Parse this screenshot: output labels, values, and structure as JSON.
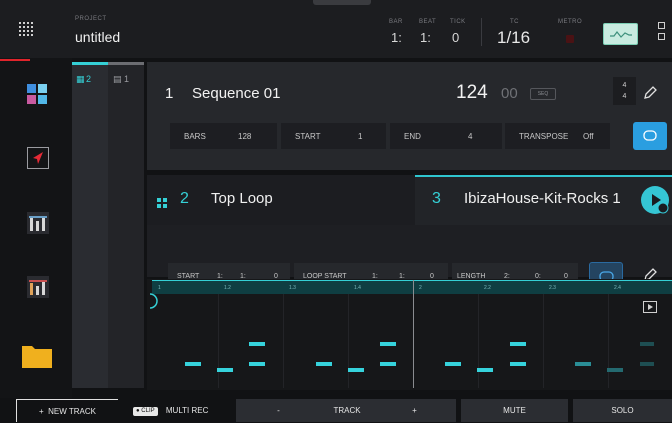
{
  "topbar": {
    "project_label": "PROJECT",
    "project_name": "untitled",
    "bar_label": "BAR",
    "beat_label": "BEAT",
    "tick_label": "TICK",
    "bar_value": "1:",
    "beat_value": "1:",
    "tick_value": "0",
    "tc_label": "TC",
    "tc_value": "1/16",
    "metro_label": "METRO"
  },
  "tracks_tabs": [
    {
      "label": "2",
      "icon": "grid-icon"
    },
    {
      "label": "1",
      "icon": "keyboard-icon"
    }
  ],
  "sequence": {
    "number": "1",
    "name": "Sequence 01",
    "bpm": "124",
    "bpm_decimal": "00",
    "seq_badge": "SEQ",
    "ts_top": "4",
    "ts_bottom": "4"
  },
  "seq_params": {
    "bars_label": "BARS",
    "bars_value": "128",
    "start_label": "START",
    "start_value": "1",
    "end_label": "END",
    "end_value": "4",
    "transpose_label": "TRANSPOSE",
    "transpose_value": "Off"
  },
  "track": {
    "number": "2",
    "name": "Top Loop",
    "program_number": "3",
    "program_name": "IbizaHouse-Kit-Rocks 1"
  },
  "loop_params": {
    "start_label": "START",
    "start_bar": "1:",
    "start_beat": "1:",
    "start_tick": "0",
    "loop_start_label": "LOOP START",
    "ls_bar": "1:",
    "ls_beat": "1:",
    "ls_tick": "0",
    "length_label": "LENGTH",
    "len_bar": "2:",
    "len_beat": "0:",
    "len_tick": "0"
  },
  "ruler": [
    "1",
    "1.2",
    "1.3",
    "1.4",
    "2",
    "2.2",
    "2.3",
    "2.4"
  ],
  "bottom": {
    "new_track": "NEW TRACK",
    "clip_badge": "CLIP",
    "multi_rec": "MULTI REC",
    "minus": "-",
    "track": "TRACK",
    "plus": "+",
    "mute": "MUTE",
    "solo": "SOLO"
  },
  "colors": {
    "accent": "#35d0d6",
    "red_accent": "#e0242b",
    "loop_blue": "#2a96d8"
  }
}
